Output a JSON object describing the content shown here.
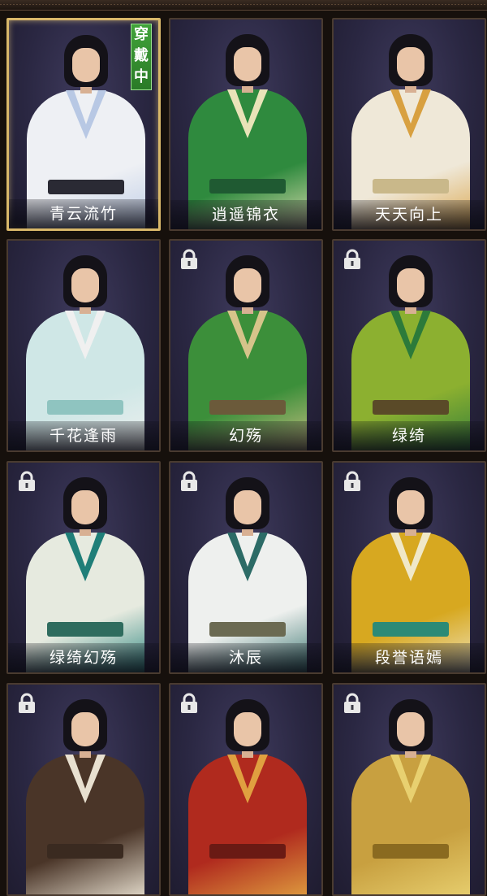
{
  "badge": {
    "lines": [
      "穿",
      "戴",
      "中"
    ]
  },
  "outfits": [
    {
      "name": "青云流竹",
      "locked": false,
      "selected": true,
      "robe": "#eef0f4",
      "trim": "#b8c8e4",
      "belt": "#2a2a34"
    },
    {
      "name": "逍遥锦衣",
      "locked": false,
      "selected": false,
      "robe": "#2f8a3e",
      "trim": "#e9e3b8",
      "belt": "#1f5a32"
    },
    {
      "name": "天天向上",
      "locked": false,
      "selected": false,
      "robe": "#efe8d8",
      "trim": "#d8a040",
      "belt": "#c9b88a"
    },
    {
      "name": "千花逢雨",
      "locked": false,
      "selected": false,
      "robe": "#cfe7e6",
      "trim": "#f0f0f0",
      "belt": "#8fc4c0"
    },
    {
      "name": "幻殇",
      "locked": true,
      "selected": false,
      "robe": "#3c8f3a",
      "trim": "#d6c48a",
      "belt": "#6b5a3a"
    },
    {
      "name": "绿绮",
      "locked": true,
      "selected": false,
      "robe": "#8cb030",
      "trim": "#2c7a3a",
      "belt": "#5a4a28"
    },
    {
      "name": "绿绮幻殇",
      "locked": true,
      "selected": false,
      "robe": "#e6eadf",
      "trim": "#1f7e78",
      "belt": "#2f6c5e"
    },
    {
      "name": "沐辰",
      "locked": true,
      "selected": false,
      "robe": "#eef0ee",
      "trim": "#2c6b66",
      "belt": "#6b6a52"
    },
    {
      "name": "段誉语嫣",
      "locked": true,
      "selected": false,
      "robe": "#d7a820",
      "trim": "#f0e8c8",
      "belt": "#2c8a76"
    },
    {
      "name": "",
      "locked": true,
      "selected": false,
      "robe": "#4a3528",
      "trim": "#e8e0d0",
      "belt": "#3a2a20"
    },
    {
      "name": "",
      "locked": true,
      "selected": false,
      "robe": "#b02a1e",
      "trim": "#e0a040",
      "belt": "#6a1a14"
    },
    {
      "name": "",
      "locked": true,
      "selected": false,
      "robe": "#c8a040",
      "trim": "#e8d070",
      "belt": "#8a6a20"
    }
  ],
  "icons": {
    "lock": "padlock-icon"
  }
}
